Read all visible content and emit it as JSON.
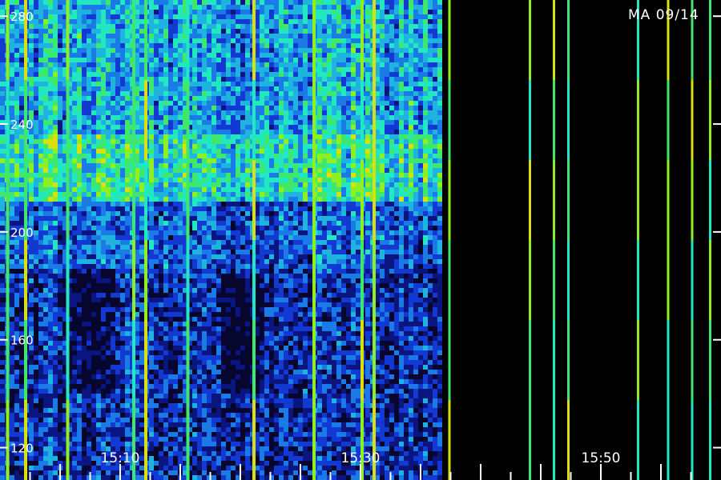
{
  "chart_data": {
    "type": "heatmap",
    "title": "",
    "stamp": "MA 09/14",
    "xlabel": "",
    "ylabel": "",
    "y_ticks": [
      120,
      160,
      200,
      240,
      280
    ],
    "ylim": [
      108,
      286
    ],
    "x_ticks": [
      "15:10",
      "15:30",
      "15:50"
    ],
    "x_axis_minutes": {
      "start": 0,
      "end": 60,
      "tick_minutes": [
        10,
        30,
        50
      ],
      "minor_step": 2.5
    },
    "colormap": [
      "#000000",
      "#06062e",
      "#0b1580",
      "#1239d2",
      "#1a7ae6",
      "#1fb4e0",
      "#22e8c0",
      "#3fe86a",
      "#8ef022",
      "#d8e010",
      "#f0a800"
    ],
    "data_gap_start_minute": 36.5,
    "bands": [
      {
        "freq": [
          212,
          236
        ],
        "intensity": 0.62
      },
      {
        "freq": [
          236,
          286
        ],
        "intensity": 0.48
      },
      {
        "freq": [
          186,
          212
        ],
        "intensity": 0.36
      },
      {
        "freq": [
          108,
          186
        ],
        "intensity": 0.26
      }
    ],
    "bright_streaks_minutes": [
      0.5,
      2,
      5.5,
      11,
      12,
      15.5,
      21,
      26,
      30,
      31,
      37.3,
      44,
      46,
      47.2,
      53,
      55.5,
      57.5,
      59
    ]
  }
}
